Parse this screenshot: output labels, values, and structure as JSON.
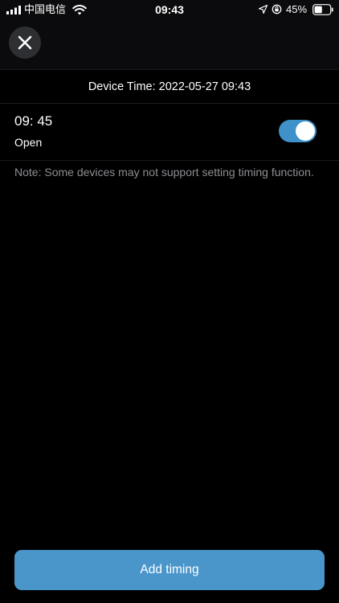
{
  "status_bar": {
    "carrier": "中国电信",
    "time": "09:43",
    "battery_percent": "45%"
  },
  "header": {
    "close_icon": "close-icon"
  },
  "device_time": {
    "text": "Device Time: 2022-05-27 09:43"
  },
  "timers": [
    {
      "time": "09: 45",
      "action": "Open",
      "enabled": true
    }
  ],
  "note": {
    "text": "Note: Some devices may not support setting timing function."
  },
  "footer": {
    "add_label": "Add timing"
  },
  "colors": {
    "accent": "#4a96cb",
    "toggle_on": "#3e91c9",
    "background": "#000000",
    "note_text": "#8e8e93"
  }
}
